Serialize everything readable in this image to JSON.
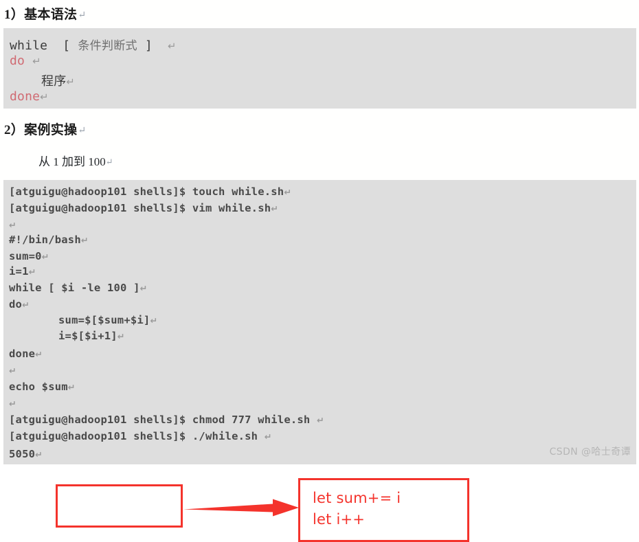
{
  "document": {
    "headings": [
      {
        "index": "1）",
        "text": "基本语法",
        "mark": "↵"
      },
      {
        "index": "2）",
        "text": "案例实操",
        "mark": "↵"
      }
    ],
    "subtext": {
      "text": "从 1 加到 100",
      "mark": "↵"
    }
  },
  "syntax_block": {
    "lines": [
      {
        "prefix": "while  [ ",
        "cjk": "条件判断式",
        "suffix": " ]  ",
        "mark": "↵",
        "style": "plain"
      },
      {
        "prefix": "do ",
        "cjk": "",
        "suffix": " ",
        "mark": "↵",
        "style": "red"
      },
      {
        "prefix": "",
        "cjk": "程序",
        "suffix": "",
        "mark": "↵",
        "style": "cjk-dark"
      },
      {
        "prefix": "done",
        "cjk": "",
        "suffix": "",
        "mark": "↵",
        "style": "red"
      }
    ]
  },
  "demo_block": {
    "lines": [
      {
        "text": "[atguigu@hadoop101 shells]$ touch while.sh",
        "mark": "↵",
        "indent": false
      },
      {
        "text": "[atguigu@hadoop101 shells]$ vim while.sh",
        "mark": "↵",
        "indent": false
      },
      {
        "text": "",
        "mark": "↵",
        "indent": false
      },
      {
        "text": "#!/bin/bash",
        "mark": "↵",
        "indent": false
      },
      {
        "text": "sum=0",
        "mark": "↵",
        "indent": false
      },
      {
        "text": "i=1",
        "mark": "↵",
        "indent": false
      },
      {
        "text": "while [ $i -le 100 ]",
        "mark": "↵",
        "indent": false
      },
      {
        "text": "do",
        "mark": "↵",
        "indent": false
      },
      {
        "text": "sum=$[$sum+$i]",
        "mark": "↵",
        "indent": true
      },
      {
        "text": "i=$[$i+1]",
        "mark": "↵",
        "indent": true
      },
      {
        "text": "done",
        "mark": "↵",
        "indent": false
      },
      {
        "text": "",
        "mark": "↵",
        "indent": false
      },
      {
        "text": "echo $sum",
        "mark": "↵",
        "indent": false
      },
      {
        "text": "",
        "mark": "↵",
        "indent": false
      },
      {
        "text": "[atguigu@hadoop101 shells]$ chmod 777 while.sh ",
        "mark": "↵",
        "indent": false
      },
      {
        "text": "[atguigu@hadoop101 shells]$ ./while.sh ",
        "mark": "↵",
        "indent": false
      },
      {
        "text": "5050",
        "mark": "↵",
        "indent": false
      }
    ]
  },
  "annotation": {
    "box_lines": [
      "let sum+= i",
      "let i++"
    ],
    "arrow_direction": "right",
    "color": "#f4332c"
  },
  "colors": {
    "panel_background": "#dedede",
    "page_background": "#ffffff",
    "code_text": "#4a4a4a",
    "keyword_red": "#d06a72",
    "annotation_red": "#f4332c",
    "pilcrow": "#9a9a9a",
    "watermark": "#b6b6b6"
  },
  "watermark": {
    "text": "CSDN @哈士奇谭"
  }
}
